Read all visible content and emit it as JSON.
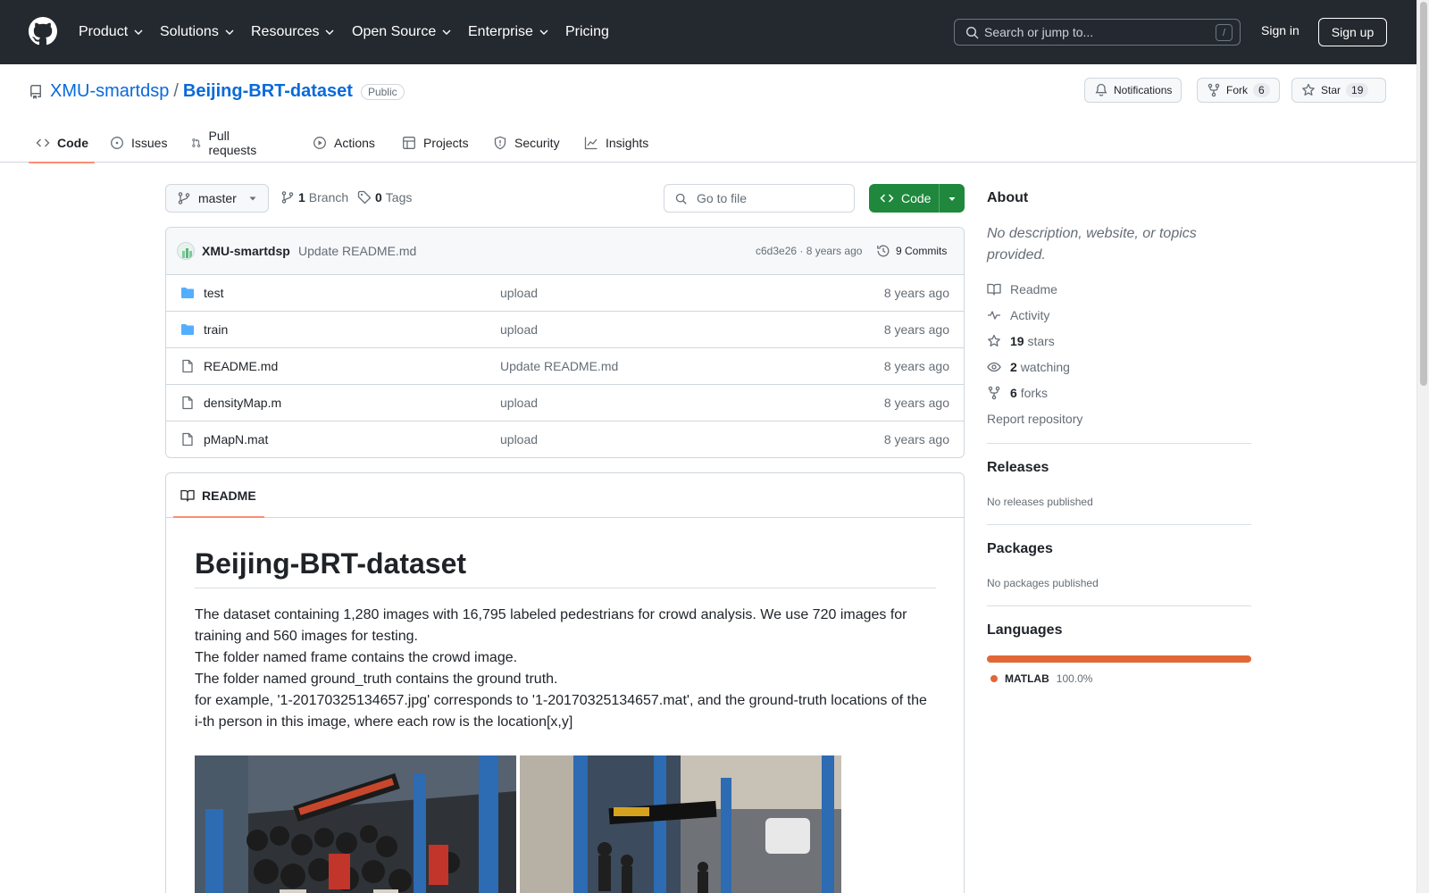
{
  "header": {
    "nav": [
      "Product",
      "Solutions",
      "Resources",
      "Open Source",
      "Enterprise",
      "Pricing"
    ],
    "search_placeholder": "Search or jump to...",
    "search_shortcut": "/",
    "sign_in": "Sign in",
    "sign_up": "Sign up"
  },
  "repo": {
    "owner": "XMU-smartdsp",
    "separator": "/",
    "name": "Beijing-BRT-dataset",
    "visibility": "Public",
    "notifications_label": "Notifications",
    "fork_label": "Fork",
    "fork_count": "6",
    "star_label": "Star",
    "star_count": "19"
  },
  "tabs": [
    "Code",
    "Issues",
    "Pull requests",
    "Actions",
    "Projects",
    "Security",
    "Insights"
  ],
  "toolbar": {
    "branch": "master",
    "branch_count": "1",
    "branch_label": "Branch",
    "tag_count": "0",
    "tag_label": "Tags",
    "goto_placeholder": "Go to file",
    "code_button": "Code"
  },
  "commit": {
    "author": "XMU-smartdsp",
    "message": "Update README.md",
    "sha_time": "c6d3e26 · 8 years ago",
    "commits": "9 Commits"
  },
  "files": [
    {
      "name": "test",
      "type": "folder",
      "message": "upload",
      "date": "8 years ago"
    },
    {
      "name": "train",
      "type": "folder",
      "message": "upload",
      "date": "8 years ago"
    },
    {
      "name": "README.md",
      "type": "file",
      "message": "Update README.md",
      "date": "8 years ago"
    },
    {
      "name": "densityMap.m",
      "type": "file",
      "message": "upload",
      "date": "8 years ago"
    },
    {
      "name": "pMapN.mat",
      "type": "file",
      "message": "upload",
      "date": "8 years ago"
    }
  ],
  "readme": {
    "tab": "README",
    "title": "Beijing-BRT-dataset",
    "lines": [
      "The dataset containing 1,280 images with 16,795 labeled pedestrians for crowd analysis. We use 720 images for training and 560 images for testing.",
      "The folder named frame contains the crowd image.",
      "The folder named ground_truth contains the ground truth.",
      "for example, '1-20170325134657.jpg' corresponds to '1-20170325134657.mat', and the ground-truth locations of the i-th person in this image, where each row is the location[x,y]"
    ]
  },
  "sidebar": {
    "about_title": "About",
    "about_desc": "No description, website, or topics provided.",
    "readme": "Readme",
    "activity": "Activity",
    "stars_count": "19",
    "stars_label": "stars",
    "watching_count": "2",
    "watching_label": "watching",
    "forks_count": "6",
    "forks_label": "forks",
    "report": "Report repository",
    "releases_title": "Releases",
    "releases_text": "No releases published",
    "packages_title": "Packages",
    "packages_text": "No packages published",
    "languages_title": "Languages",
    "language_name": "MATLAB",
    "language_pct": "100.0%",
    "language_color": "#e16737"
  },
  "colors": {
    "header_bg": "#24292f",
    "link": "#0969da",
    "accent_underline": "#fd8c73",
    "code_button_bg": "#1f883d"
  }
}
